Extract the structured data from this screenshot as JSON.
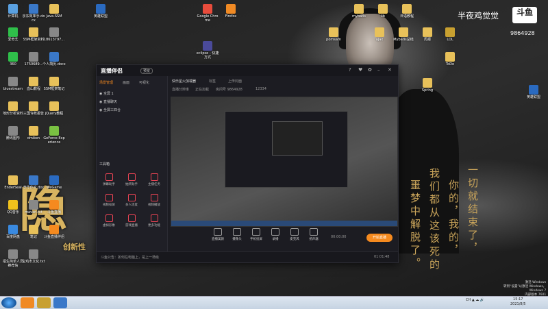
{
  "wallpaper": {
    "watermark_text": "半夜鸡觉觉",
    "logo_text": "斗鱼",
    "room_number": "9864928",
    "big_char": "隐",
    "brand_text": "创新性",
    "poem_lines": [
      "一切就结束了，",
      "你的，我的，",
      "我们都从这该死的",
      "噩梦中解脱了。"
    ]
  },
  "desktop_icons": [
    {
      "label": "计算机",
      "color": "#5aa0e0"
    },
    {
      "label": "京东效率手.docx",
      "color": "#3a78c8"
    },
    {
      "label": "Java-SSM",
      "color": "#e8c15a"
    },
    {
      "label": "英雄联盟",
      "color": "#2a6ac0"
    },
    {
      "label": "Google Chrome",
      "color": "#e84c3c"
    },
    {
      "label": "Firefox",
      "color": "#f08a24"
    },
    {
      "label": "mybatis",
      "color": "#e8c15a"
    },
    {
      "label": "lib",
      "color": "#e8c15a"
    },
    {
      "label": "日语教程",
      "color": "#e8c15a"
    },
    {
      "label": "爱奇艺",
      "color": "#2fbf4a"
    },
    {
      "label": "SSM框架资料",
      "color": "#e8c15a"
    },
    {
      "label": "18613797...",
      "color": "#888"
    },
    {
      "label": "eclipse - 快捷方式",
      "color": "#4a4a9a"
    },
    {
      "label": "pomsam",
      "color": "#e8c15a"
    },
    {
      "label": "ajax",
      "color": "#e8c15a"
    },
    {
      "label": "Mybatis总结",
      "color": "#e8c15a"
    },
    {
      "label": "周报",
      "color": "#e8c15a"
    },
    {
      "label": "LOL",
      "color": "#c8a030"
    },
    {
      "label": "360",
      "color": "#2fbf4a"
    },
    {
      "label": "1750689...",
      "color": "#888"
    },
    {
      "label": "个人简历.docx",
      "color": "#3a78c8"
    },
    {
      "label": "Spring",
      "color": "#e8c15a"
    },
    {
      "label": "ToDo",
      "color": "#e8c15a"
    },
    {
      "label": "bluestream",
      "color": "#888"
    },
    {
      "label": "血山教程",
      "color": "#e8c15a"
    },
    {
      "label": "SSM框架笔记",
      "color": "#e8c15a"
    },
    {
      "label": "地形分析资料",
      "color": "#e8c15a"
    },
    {
      "label": "三国许攸报告",
      "color": "#e8c15a"
    },
    {
      "label": "jQuery教程",
      "color": "#e8c15a"
    },
    {
      "label": "英雄联盟",
      "color": "#2a6ac0"
    },
    {
      "label": "腾讯图形",
      "color": "#888"
    },
    {
      "label": "dmiken",
      "color": "#e8c15a"
    },
    {
      "label": "GeForce Experience",
      "color": "#7ac142"
    },
    {
      "label": "EnderSeal",
      "color": "#e8c15a"
    },
    {
      "label": "李华作文.doc",
      "color": "#3a78c8"
    },
    {
      "label": "WeGame",
      "color": "#2a6ac0"
    },
    {
      "label": "QQ音乐",
      "color": "#f0c21c"
    },
    {
      "label": "maven.txt",
      "color": "#888"
    },
    {
      "label": "斗鱼直播",
      "color": "#f58a1f"
    },
    {
      "label": "百度网盘",
      "color": "#3a8ae0"
    },
    {
      "label": "笔记",
      "color": "#e8c15a"
    },
    {
      "label": "斗鱼直播伴侣",
      "color": "#f58a1f"
    },
    {
      "label": "招生简单人员推荐信",
      "color": "#888"
    },
    {
      "label": "宝鸡市文化.txt",
      "color": "#888"
    }
  ],
  "app": {
    "logo": "直播伴侣",
    "badge": "预览",
    "scene_tabs": [
      "场景管理",
      "画面",
      "可视化"
    ],
    "scenes": [
      "全屏 1",
      "直播聊天",
      "全屏三四合"
    ],
    "section_title": "工具箱",
    "tools": [
      "弹幕助手",
      "抽奖助手",
      "主播任务",
      "视频投屏",
      "多人连麦",
      "视频播放",
      "虚拟形象",
      "游戏直播",
      "更多功能"
    ],
    "header_title": "快乐星火加载器",
    "header_tag": "标签",
    "header_action": "上传封面",
    "status_items": [
      "直播分辨率",
      "正在加载",
      "房间号 9864928",
      "12334"
    ],
    "bottom_buttons": [
      "直播美颜",
      "摄像头",
      "手机投屏",
      "录播",
      "麦克风",
      "扬声器"
    ],
    "live_button": "开始直播",
    "timer_a": "00:00:00",
    "timer_b": "01:01:48",
    "statusbar_left": "斗鱼公告：如何在电脑上，是上一场级"
  },
  "taskbar": {
    "tray_text": "CH ▲ ☁ 🔊",
    "time": "15:17",
    "date": "2021/8/5"
  },
  "windows_notice": [
    "激活 Windows",
    "转到“设置”以激活 Windows。",
    "Windows 7",
    "内部版本 7601"
  ]
}
